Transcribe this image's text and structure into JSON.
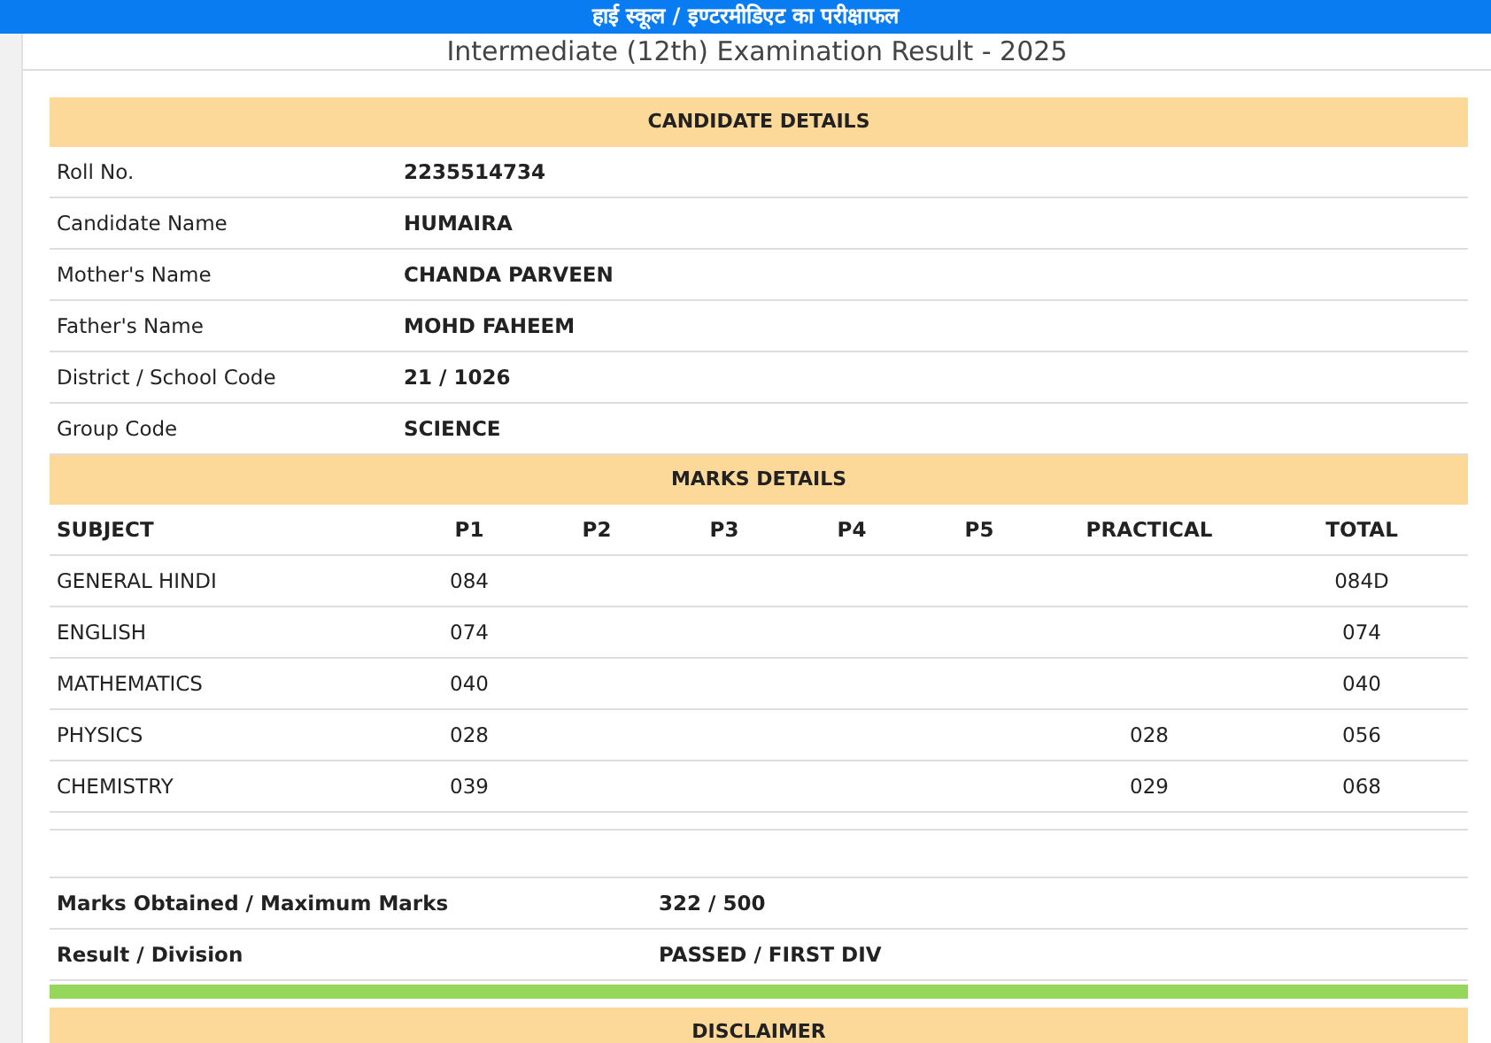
{
  "top_bar": {
    "title": "हाई स्कूल / इण्टरमीडिएट का परीक्षाफल"
  },
  "page_title": "Intermediate (12th) Examination Result - 2025",
  "candidate_details": {
    "heading": "CANDIDATE DETAILS",
    "rows": [
      {
        "label": "Roll No.",
        "value": "2235514734"
      },
      {
        "label": "Candidate Name",
        "value": "HUMAIRA"
      },
      {
        "label": "Mother's Name",
        "value": "CHANDA PARVEEN"
      },
      {
        "label": "Father's Name",
        "value": "MOHD FAHEEM"
      },
      {
        "label": "District / School Code",
        "value": "21 / 1026"
      },
      {
        "label": "Group Code",
        "value": "SCIENCE"
      }
    ]
  },
  "marks_details": {
    "heading": "MARKS DETAILS",
    "columns": [
      "SUBJECT",
      "P1",
      "P2",
      "P3",
      "P4",
      "P5",
      "PRACTICAL",
      "TOTAL"
    ],
    "rows": [
      [
        "GENERAL HINDI",
        "084",
        "",
        "",
        "",
        "",
        "",
        "084D"
      ],
      [
        "ENGLISH",
        "074",
        "",
        "",
        "",
        "",
        "",
        "074"
      ],
      [
        "MATHEMATICS",
        "040",
        "",
        "",
        "",
        "",
        "",
        "040"
      ],
      [
        "PHYSICS",
        "028",
        "",
        "",
        "",
        "",
        "028",
        "056"
      ],
      [
        "CHEMISTRY",
        "039",
        "",
        "",
        "",
        "",
        "029",
        "068"
      ]
    ]
  },
  "summary": [
    {
      "label": "Marks Obtained / Maximum Marks",
      "value": "322 / 500"
    },
    {
      "label": "Result / Division",
      "value": "PASSED / FIRST DIV"
    }
  ],
  "result_bar": {
    "color": "#95d75b"
  },
  "disclaimer": {
    "heading": "DISCLAIMER"
  }
}
